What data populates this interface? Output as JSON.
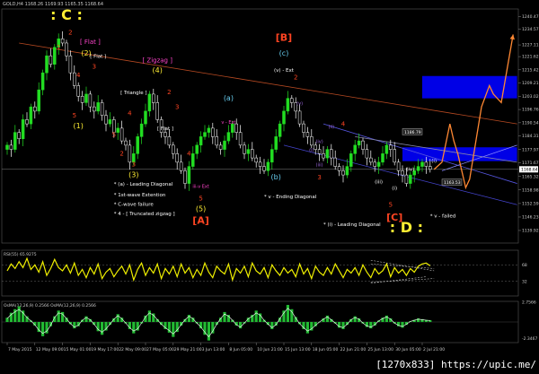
{
  "header": "GOLD,H4 1168.26 1169.93 1165.35 1168.64",
  "watermark": "[1270x833] https://upic.me/",
  "colors": {
    "background": "#000000",
    "bull_candle": "#22dd22",
    "bear_candle": "#ffffff",
    "trend_upper": "#b84a22",
    "trend_lower": "#4444cc",
    "forecast": "#ff8833",
    "rsi_line": "#eeee00",
    "osma_hist": "#22bb33",
    "blue_zone": "#0000e6",
    "wave_yellow": "#ffee33",
    "wave_red": "#ff4422",
    "wave_cyan": "#66ccee",
    "wave_magenta": "#ff44cc",
    "wave_white": "#ffffff",
    "wave_purple": "#9966dd"
  },
  "main_axis": {
    "ylim": [
      1134.0,
      1244.0
    ]
  },
  "price_labels": [
    {
      "v": 1240.47,
      "t": "1240.47"
    },
    {
      "v": 1234.57,
      "t": "1234.57"
    },
    {
      "v": 1227.11,
      "t": "1227.11"
    },
    {
      "v": 1221.62,
      "t": "1221.62"
    },
    {
      "v": 1215.42,
      "t": "1215.42"
    },
    {
      "v": 1209.21,
      "t": "1209.21"
    },
    {
      "v": 1203.02,
      "t": "1203.02"
    },
    {
      "v": 1196.76,
      "t": "1196.76"
    },
    {
      "v": 1190.54,
      "t": "1190.54"
    },
    {
      "v": 1184.31,
      "t": "1184.31"
    },
    {
      "v": 1177.97,
      "t": "1177.97"
    },
    {
      "v": 1171.67,
      "t": "1171.67"
    },
    {
      "v": 1165.32,
      "t": "1165.32"
    },
    {
      "v": 1158.98,
      "t": "1158.98"
    },
    {
      "v": 1152.59,
      "t": "1152.59"
    },
    {
      "v": 1146.23,
      "t": "1146.23"
    },
    {
      "v": 1139.92,
      "t": "1139.92"
    }
  ],
  "current_price": {
    "v": 1168.64,
    "t": "1168.64"
  },
  "price_tags": [
    {
      "t": "1186.79",
      "v": 1186.3,
      "i": 100
    },
    {
      "t": "1163.53",
      "v": 1162.6,
      "i": 110
    }
  ],
  "date_labels": [
    {
      "i": 0,
      "t": "7 May 2015"
    },
    {
      "i": 7,
      "t": "12 May 09:00"
    },
    {
      "i": 14,
      "t": "15 May 01:00"
    },
    {
      "i": 21,
      "t": "19 May 17:00"
    },
    {
      "i": 28,
      "t": "22 May 09:00"
    },
    {
      "i": 35,
      "t": "27 May 05:00"
    },
    {
      "i": 42,
      "t": "29 May 21:00"
    },
    {
      "i": 49,
      "t": "3 Jun 13:00"
    },
    {
      "i": 56,
      "t": "8 Jun 05:00"
    },
    {
      "i": 63,
      "t": "10 Jun 21:00"
    },
    {
      "i": 70,
      "t": "15 Jun 13:00"
    },
    {
      "i": 77,
      "t": "18 Jun 05:00"
    },
    {
      "i": 84,
      "t": "22 Jun 21:00"
    },
    {
      "i": 91,
      "t": "25 Jun 13:00"
    },
    {
      "i": 98,
      "t": "30 Jun 05:00"
    },
    {
      "i": 105,
      "t": "2 Jul 21:00"
    }
  ],
  "chart_data": [
    {
      "type": "candlestick",
      "title": "GOLD,H4",
      "ylim": [
        1134.0,
        1244.0
      ],
      "closes": [
        1180,
        1178,
        1186,
        1183,
        1192,
        1190,
        1198,
        1196,
        1206,
        1214,
        1222,
        1218,
        1226,
        1230,
        1228,
        1222,
        1214,
        1208,
        1203,
        1200,
        1204,
        1198,
        1196,
        1200,
        1194,
        1190,
        1192,
        1186,
        1188,
        1182,
        1180,
        1172,
        1176,
        1184,
        1190,
        1196,
        1204,
        1200,
        1192,
        1186,
        1184,
        1180,
        1176,
        1172,
        1168,
        1162,
        1170,
        1176,
        1180,
        1184,
        1186,
        1188,
        1184,
        1180,
        1178,
        1182,
        1186,
        1190,
        1186,
        1180,
        1176,
        1178,
        1174,
        1172,
        1170,
        1168,
        1172,
        1178,
        1184,
        1190,
        1196,
        1202,
        1200,
        1196,
        1190,
        1186,
        1184,
        1180,
        1178,
        1176,
        1174,
        1178,
        1174,
        1170,
        1168,
        1166,
        1170,
        1176,
        1180,
        1182,
        1178,
        1174,
        1172,
        1170,
        1172,
        1176,
        1180,
        1178,
        1172,
        1168,
        1166,
        1162,
        1166,
        1168,
        1170,
        1172,
        1170,
        1168.64
      ],
      "forecast": [
        [
          108,
          1168.6
        ],
        [
          110,
          1172.0
        ],
        [
          112,
          1190.0
        ],
        [
          113,
          1182.0
        ],
        [
          114,
          1176.0
        ],
        [
          116,
          1160.0
        ],
        [
          117,
          1164.0
        ],
        [
          120,
          1198.0
        ],
        [
          122,
          1208.0
        ],
        [
          123,
          1204.0
        ],
        [
          125,
          1200.0
        ],
        [
          128,
          1232.0
        ]
      ],
      "blue_zones": [
        {
          "x0": 105,
          "x1": 129,
          "y0": 1202.0,
          "y1": 1212.5
        },
        {
          "x0": 100,
          "x1": 129,
          "y0": 1172.5,
          "y1": 1179.0
        }
      ],
      "trend_lines": [
        {
          "name": "upper-channel",
          "color": "#b84a22",
          "from": [
            3,
            1228.0
          ],
          "to": [
            129,
            1190.0
          ]
        },
        {
          "name": "lower-channel",
          "color": "#4444cc",
          "from": [
            70,
            1180.0
          ],
          "to": [
            129,
            1152.0
          ]
        },
        {
          "name": "inner-lower",
          "color": "#5555dd",
          "from": [
            80,
            1190.0
          ],
          "to": [
            129,
            1162.0
          ]
        },
        {
          "name": "ending-diagonal-top",
          "color": "#8888aa",
          "from": [
            88,
            1184.0
          ],
          "to": [
            129,
            1172.0
          ]
        },
        {
          "name": "forecast-arrow",
          "color": "#8888ff",
          "from": [
            110,
            1168.0
          ],
          "to": [
            129,
            1180.0
          ]
        }
      ],
      "wave_labels": [
        {
          "t": ": C :",
          "i": 15,
          "v": 1239,
          "c": "yellow",
          "s": 16
        },
        {
          "t": "1",
          "i": 13,
          "v": 1225,
          "c": "red",
          "s": 7
        },
        {
          "t": "2",
          "i": 16,
          "v": 1232,
          "c": "red",
          "s": 7
        },
        {
          "t": "[ Flat ]",
          "i": 21,
          "v": 1227.5,
          "c": "magenta",
          "s": 7
        },
        {
          "t": "(2)",
          "i": 20,
          "v": 1222,
          "c": "yellow",
          "s": 8
        },
        {
          "t": "[ Flat ]",
          "i": 23,
          "v": 1221,
          "c": "white",
          "s": 5.5
        },
        {
          "t": "3",
          "i": 22,
          "v": 1216,
          "c": "red",
          "s": 7
        },
        {
          "t": "4",
          "i": 18,
          "v": 1212,
          "c": "red",
          "s": 7
        },
        {
          "t": "5",
          "i": 17,
          "v": 1193,
          "c": "red",
          "s": 7
        },
        {
          "t": "(1)",
          "i": 18,
          "v": 1188,
          "c": "yellow",
          "s": 8
        },
        {
          "t": "[ Zigzag ]",
          "i": 38,
          "v": 1219,
          "c": "magenta",
          "s": 7
        },
        {
          "t": "(4)",
          "i": 38,
          "v": 1214,
          "c": "yellow",
          "s": 8
        },
        {
          "t": "[ Triangle ]",
          "i": 32,
          "v": 1204,
          "c": "white",
          "s": 5.5
        },
        {
          "t": "2",
          "i": 41,
          "v": 1204,
          "c": "red",
          "s": 7
        },
        {
          "t": "3",
          "i": 43,
          "v": 1197,
          "c": "red",
          "s": 7
        },
        {
          "t": "4",
          "i": 31,
          "v": 1194,
          "c": "red",
          "s": 7
        },
        {
          "t": "[ Flat ]",
          "i": 40,
          "v": 1187,
          "c": "white",
          "s": 5.5
        },
        {
          "t": "5",
          "i": 27,
          "v": 1184,
          "c": "red",
          "s": 7
        },
        {
          "t": "2",
          "i": 29,
          "v": 1175,
          "c": "red",
          "s": 7
        },
        {
          "t": "3",
          "i": 32,
          "v": 1170,
          "c": "red",
          "s": 7
        },
        {
          "t": "(3)",
          "i": 32,
          "v": 1165,
          "c": "yellow",
          "s": 8
        },
        {
          "t": "4",
          "i": 46,
          "v": 1175,
          "c": "red",
          "s": 7
        },
        {
          "t": "5",
          "i": 49,
          "v": 1154,
          "c": "red",
          "s": 7
        },
        {
          "t": "(5)",
          "i": 49,
          "v": 1149,
          "c": "yellow",
          "s": 8
        },
        {
          "t": "[A]",
          "i": 49,
          "v": 1143,
          "c": "red",
          "s": 11
        },
        {
          "t": "iii-v Ext",
          "i": 49,
          "v": 1160,
          "c": "magenta",
          "s": 5
        },
        {
          "t": "(a)",
          "i": 56,
          "v": 1201,
          "c": "cyan",
          "s": 8
        },
        {
          "t": "v - Ext",
          "i": 56,
          "v": 1190,
          "c": "magenta",
          "s": 5
        },
        {
          "t": "[B]",
          "i": 70,
          "v": 1229,
          "c": "red",
          "s": 11
        },
        {
          "t": "(c)",
          "i": 70,
          "v": 1222,
          "c": "cyan",
          "s": 8
        },
        {
          "t": "(v) - Ext",
          "i": 70,
          "v": 1214.5,
          "c": "white",
          "s": 5.5
        },
        {
          "t": "2",
          "i": 73,
          "v": 1211,
          "c": "red",
          "s": 7
        },
        {
          "t": "(b)",
          "i": 68,
          "v": 1164,
          "c": "cyan",
          "s": 8
        },
        {
          "t": "4",
          "i": 85,
          "v": 1189,
          "c": "red",
          "s": 7
        },
        {
          "t": "3",
          "i": 79,
          "v": 1164,
          "c": "red",
          "s": 7
        },
        {
          "t": "(iii)",
          "i": 79,
          "v": 1170,
          "c": "purple",
          "s": 5
        },
        {
          "t": "(iv)",
          "i": 79,
          "v": 1181,
          "c": "purple",
          "s": 5
        },
        {
          "t": "(v)",
          "i": 74,
          "v": 1199,
          "c": "purple",
          "s": 5
        },
        {
          "t": "(ii)",
          "i": 82,
          "v": 1188,
          "c": "purple",
          "s": 5
        },
        {
          "t": "(i)",
          "i": 77,
          "v": 1177,
          "c": "purple",
          "s": 5
        },
        {
          "t": "5",
          "i": 97,
          "v": 1151,
          "c": "red",
          "s": 7
        },
        {
          "t": "[C]",
          "i": 98,
          "v": 1144.5,
          "c": "red",
          "s": 11
        },
        {
          "t": ": D :",
          "i": 101,
          "v": 1139,
          "c": "yellow",
          "s": 16
        },
        {
          "t": "(i)",
          "i": 98,
          "v": 1159,
          "c": "white",
          "s": 5.5
        },
        {
          "t": "(iii)",
          "i": 94,
          "v": 1162,
          "c": "white",
          "s": 5.5
        },
        {
          "t": "(i)",
          "i": 108,
          "v": 1172,
          "c": "white",
          "s": 5.5
        },
        {
          "t": "(iv)",
          "i": 102,
          "v": 1168,
          "c": "white",
          "s": 5.5
        }
      ],
      "annotations": [
        {
          "t": "*  (a) - Leading Diagonal",
          "i": 27,
          "v": 1161
        },
        {
          "t": "*  1st-wave Extention",
          "i": 27,
          "v": 1156
        },
        {
          "t": "*  C-wave failure",
          "i": 27,
          "v": 1151.5
        },
        {
          "t": "*  4 - [ Truncated zigzag ]",
          "i": 27,
          "v": 1147
        },
        {
          "t": "*  v - Ending Diagonal",
          "i": 65,
          "v": 1155
        },
        {
          "t": "*  (i) - Leading Diagonal",
          "i": 80,
          "v": 1142
        },
        {
          "t": "*  v - failed",
          "i": 107,
          "v": 1146
        }
      ]
    },
    {
      "type": "line",
      "title": "RSI(55) 65.9275",
      "ylim": [
        0,
        100
      ],
      "levels": [
        {
          "v": 68,
          "t": "68"
        },
        {
          "v": 32,
          "t": "32"
        }
      ],
      "values": [
        55,
        70,
        60,
        75,
        62,
        82,
        58,
        68,
        52,
        75,
        45,
        60,
        80,
        62,
        55,
        68,
        50,
        72,
        45,
        58,
        40,
        62,
        48,
        70,
        38,
        52,
        60,
        42,
        55,
        65,
        48,
        68,
        35,
        58,
        72,
        45,
        62,
        50,
        70,
        38,
        60,
        48,
        65,
        42,
        70,
        50,
        62,
        40,
        58,
        45,
        72,
        52,
        40,
        65,
        55,
        48,
        70,
        35,
        60,
        50,
        65,
        42,
        72,
        55,
        48,
        62,
        40,
        68,
        55,
        45,
        62,
        50,
        58,
        42,
        70,
        48,
        60,
        38,
        65,
        52,
        45,
        62,
        48,
        70,
        55,
        40,
        58,
        50,
        62,
        45,
        68,
        52,
        40,
        60,
        48,
        55,
        70,
        42,
        62,
        50,
        58,
        45,
        60,
        52,
        65,
        70,
        72,
        66
      ],
      "triangle_lines": [
        [
          92,
          78,
          108,
          55
        ],
        [
          92,
          70,
          108,
          60
        ],
        [
          92,
          30,
          108,
          38
        ],
        [
          92,
          28,
          106,
          42
        ]
      ],
      "current_label": "65.9275"
    },
    {
      "type": "bar",
      "title": "OsMA(12,26,9) 0.2566 OsMA(12,26,9) 0.2566",
      "ylim": [
        -2.9,
        2.9
      ],
      "axis_labels": [
        {
          "v": 2.7566,
          "t": "2.7566"
        },
        {
          "v": -2.3467,
          "t": "-2.3467"
        }
      ],
      "values": [
        0.6,
        1.3,
        1.8,
        2.2,
        1.6,
        0.8,
        0.2,
        -0.5,
        -1.4,
        -2.0,
        -1.6,
        -0.6,
        0.8,
        1.6,
        1.4,
        0.6,
        -0.3,
        -0.9,
        -0.6,
        0.3,
        0.8,
        0.4,
        -0.4,
        -1.3,
        -1.8,
        -1.2,
        -0.4,
        0.5,
        1.1,
        0.6,
        -0.2,
        -1.0,
        -1.6,
        -1.2,
        -0.2,
        0.9,
        1.6,
        1.2,
        0.4,
        -0.4,
        -1.0,
        -1.5,
        -2.1,
        -1.4,
        -0.5,
        0.4,
        1.0,
        0.6,
        -0.2,
        -0.9,
        -1.8,
        -2.6,
        -1.6,
        -0.4,
        0.6,
        1.4,
        1.0,
        0.3,
        -0.5,
        -0.9,
        -0.2,
        0.6,
        1.0,
        1.6,
        1.2,
        0.3,
        -0.4,
        -1.0,
        -0.5,
        0.6,
        1.6,
        2.4,
        1.8,
        0.7,
        -0.3,
        -1.0,
        -1.6,
        -1.2,
        -0.6,
        0.0,
        0.5,
        0.9,
        0.4,
        -0.2,
        -0.8,
        -1.0,
        -0.4,
        0.4,
        0.8,
        0.5,
        -0.2,
        -0.7,
        -0.9,
        -0.5,
        0.2,
        0.6,
        0.9,
        0.5,
        -0.2,
        -0.6,
        -0.8,
        -0.4,
        0.1,
        0.3,
        0.5,
        0.4,
        0.3,
        0.26
      ]
    }
  ]
}
